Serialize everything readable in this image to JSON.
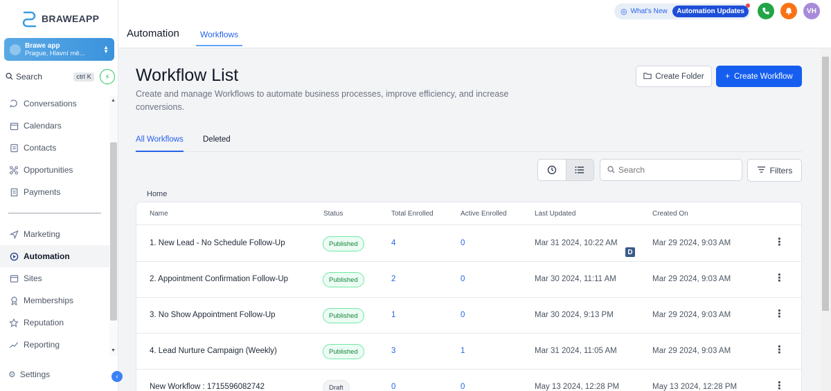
{
  "brand": {
    "name": "BRAWEAPP"
  },
  "account": {
    "name": "Brawe app",
    "location": "Prague, Hlavní mě..."
  },
  "sidebar_search": {
    "label": "Search",
    "shortcut": "ctrl K"
  },
  "sidebar": {
    "items": [
      {
        "label": "Conversations",
        "icon": "chat-icon"
      },
      {
        "label": "Calendars",
        "icon": "calendar-icon"
      },
      {
        "label": "Contacts",
        "icon": "contacts-icon"
      },
      {
        "label": "Opportunities",
        "icon": "opportunities-icon"
      },
      {
        "label": "Payments",
        "icon": "payments-icon"
      }
    ],
    "items2": [
      {
        "label": "Marketing",
        "icon": "send-icon"
      },
      {
        "label": "Automation",
        "icon": "automation-icon",
        "active": true
      },
      {
        "label": "Sites",
        "icon": "sites-icon"
      },
      {
        "label": "Memberships",
        "icon": "memberships-icon"
      },
      {
        "label": "Reputation",
        "icon": "star-icon"
      },
      {
        "label": "Reporting",
        "icon": "chart-icon"
      }
    ],
    "settings_label": "Settings"
  },
  "header": {
    "title": "Automation",
    "tab": "Workflows",
    "whats_new": "What's New",
    "updates_pill": "Automation Updates",
    "avatar_initials": "VH"
  },
  "main": {
    "title": "Workflow List",
    "description": "Create and manage Workflows to automate business processes, improve efficiency, and increase conversions.",
    "create_folder": "Create Folder",
    "create_workflow": "Create Workflow",
    "tabs": [
      "All Workflows",
      "Deleted"
    ],
    "search_placeholder": "Search",
    "filters": "Filters",
    "breadcrumb": "Home"
  },
  "table": {
    "headers": [
      "Name",
      "Status",
      "Total Enrolled",
      "Active Enrolled",
      "Last Updated",
      "Created On"
    ],
    "rows": [
      {
        "name": "1. New Lead - No Schedule Follow-Up",
        "status": "Published",
        "total": "4",
        "active": "0",
        "updated": "Mar 31 2024, 10:22 AM",
        "created": "Mar 29 2024, 9:03 AM"
      },
      {
        "name": "2. Appointment Confirmation Follow-Up",
        "status": "Published",
        "total": "2",
        "active": "0",
        "updated": "Mar 30 2024, 11:11 AM",
        "created": "Mar 29 2024, 9:03 AM"
      },
      {
        "name": "3. No Show Appointment Follow-Up",
        "status": "Published",
        "total": "1",
        "active": "0",
        "updated": "Mar 30 2024, 9:13 PM",
        "created": "Mar 29 2024, 9:03 AM"
      },
      {
        "name": "4. Lead Nurture Campaign (Weekly)",
        "status": "Published",
        "total": "3",
        "active": "1",
        "updated": "Mar 31 2024, 11:05 AM",
        "created": "Mar 29 2024, 9:03 AM"
      },
      {
        "name": "New Workflow : 1715596082742",
        "status": "Draft",
        "total": "0",
        "active": "0",
        "updated": "May 13 2024, 12:28 PM",
        "created": "May 13 2024, 12:28 PM"
      }
    ]
  },
  "floating_badge": "D",
  "colors": {
    "primary": "#155eef",
    "published_border": "#6ee7a6",
    "link": "#2563eb"
  }
}
